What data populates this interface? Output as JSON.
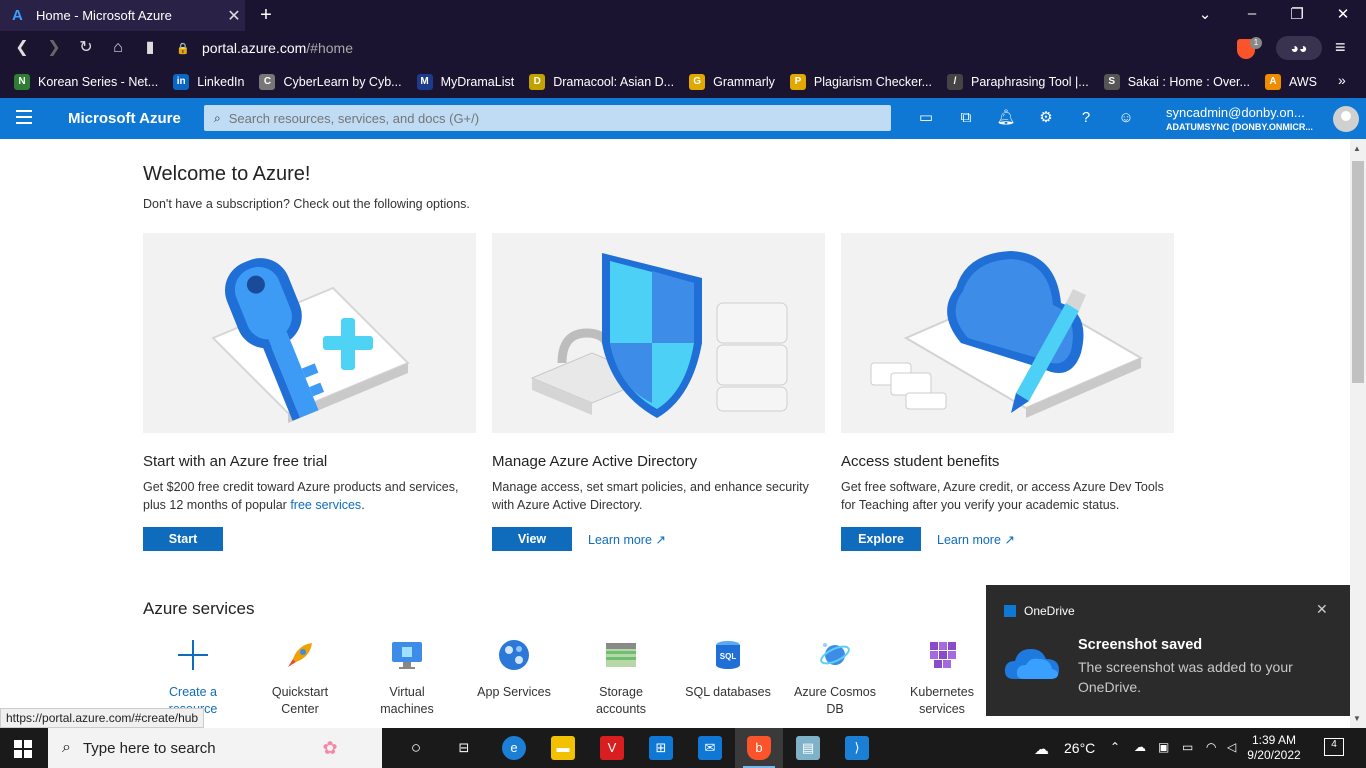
{
  "browser": {
    "tab_title": "Home - Microsoft Azure",
    "url_host": "portal.azure.com",
    "url_path": "/#home",
    "shield_count": "1",
    "bookmarks": [
      {
        "label": "Korean Series - Net...",
        "color": "#2e7d32",
        "glyph": "N"
      },
      {
        "label": "LinkedIn",
        "color": "#0a66c2",
        "glyph": "in"
      },
      {
        "label": "CyberLearn by Cyb...",
        "color": "#777777",
        "glyph": "C"
      },
      {
        "label": "MyDramaList",
        "color": "#1e3a8a",
        "glyph": "M"
      },
      {
        "label": "Dramacool: Asian D...",
        "color": "#c2a200",
        "glyph": "D"
      },
      {
        "label": "Grammarly",
        "color": "#e0a800",
        "glyph": "G"
      },
      {
        "label": "Plagiarism Checker...",
        "color": "#e0a800",
        "glyph": "P"
      },
      {
        "label": "Paraphrasing Tool |...",
        "color": "#444444",
        "glyph": "/"
      },
      {
        "label": "Sakai : Home : Over...",
        "color": "#555555",
        "glyph": "S"
      },
      {
        "label": "AWS",
        "color": "#f08c00",
        "glyph": "A"
      }
    ]
  },
  "azure": {
    "brand": "Microsoft Azure",
    "search_placeholder": "Search resources, services, and docs (G+/)",
    "user_name": "syncadmin@donby.on...",
    "user_tenant": "ADATUMSYNC (DONBY.ONMICR..."
  },
  "welcome": {
    "title": "Welcome to Azure!",
    "subtitle": "Don't have a subscription? Check out the following options."
  },
  "cards": [
    {
      "title": "Start with an Azure free trial",
      "desc": "Get $200 free credit toward Azure products and services, plus 12 months of popular ",
      "link": "free services",
      "desc_end": ".",
      "button": "Start"
    },
    {
      "title": "Manage Azure Active Directory",
      "desc": "Manage access, set smart policies, and enhance security with Azure Active Directory.",
      "button": "View",
      "learn_more": "Learn more"
    },
    {
      "title": "Access student benefits",
      "desc": "Get free software, Azure credit, or access Azure Dev Tools for Teaching after you verify your academic status.",
      "button": "Explore",
      "learn_more": "Learn more"
    }
  ],
  "services": {
    "title": "Azure services",
    "items": [
      {
        "line1": "Create a",
        "line2": "resource"
      },
      {
        "line1": "Quickstart",
        "line2": "Center"
      },
      {
        "line1": "Virtual",
        "line2": "machines"
      },
      {
        "line1": "App Services",
        "line2": ""
      },
      {
        "line1": "Storage",
        "line2": "accounts"
      },
      {
        "line1": "SQL databases",
        "line2": ""
      },
      {
        "line1": "Azure Cosmos",
        "line2": "DB"
      },
      {
        "line1": "Kubernetes",
        "line2": "services"
      }
    ]
  },
  "status_url": "https://portal.azure.com/#create/hub",
  "toast": {
    "app": "OneDrive",
    "title": "Screenshot saved",
    "body": "The screenshot was added to your OneDrive."
  },
  "taskbar": {
    "search_placeholder": "Type here to search",
    "temperature": "26°C",
    "time": "1:39 AM",
    "date": "9/20/2022",
    "notification_count": "4"
  }
}
